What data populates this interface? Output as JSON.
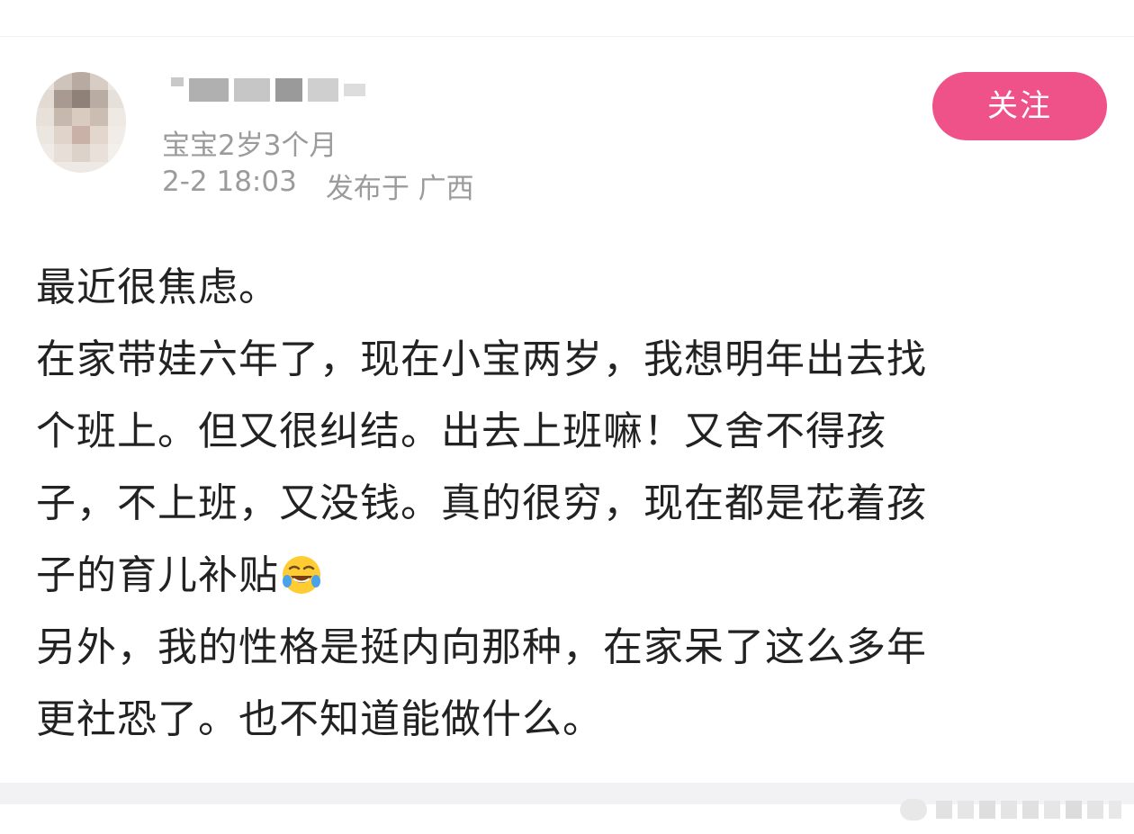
{
  "post": {
    "author": {
      "username": "",
      "baby_age": "宝宝2岁3个月"
    },
    "date": "2-2 18:03",
    "location": "发布于 广西",
    "follow_label": "关注",
    "lines": [
      "最近很焦虑。",
      "在家带娃六年了，现在小宝两岁，我想明年出去找",
      "个班上。但又很纠结。出去上班嘛！又舍不得孩",
      "子，不上班，又没钱。真的很穷，现在都是花着孩",
      "子的育儿补贴",
      "另外，我的性格是挺内向那种，在家呆了这么多年",
      "更社恐了。也不知道能做什么。"
    ],
    "emoji": "crying-laughing-emoji"
  },
  "colors": {
    "accent": "#ee5289",
    "meta_text": "#9b9b9b",
    "body_text": "#222222",
    "divider": "#f2f2f5"
  }
}
